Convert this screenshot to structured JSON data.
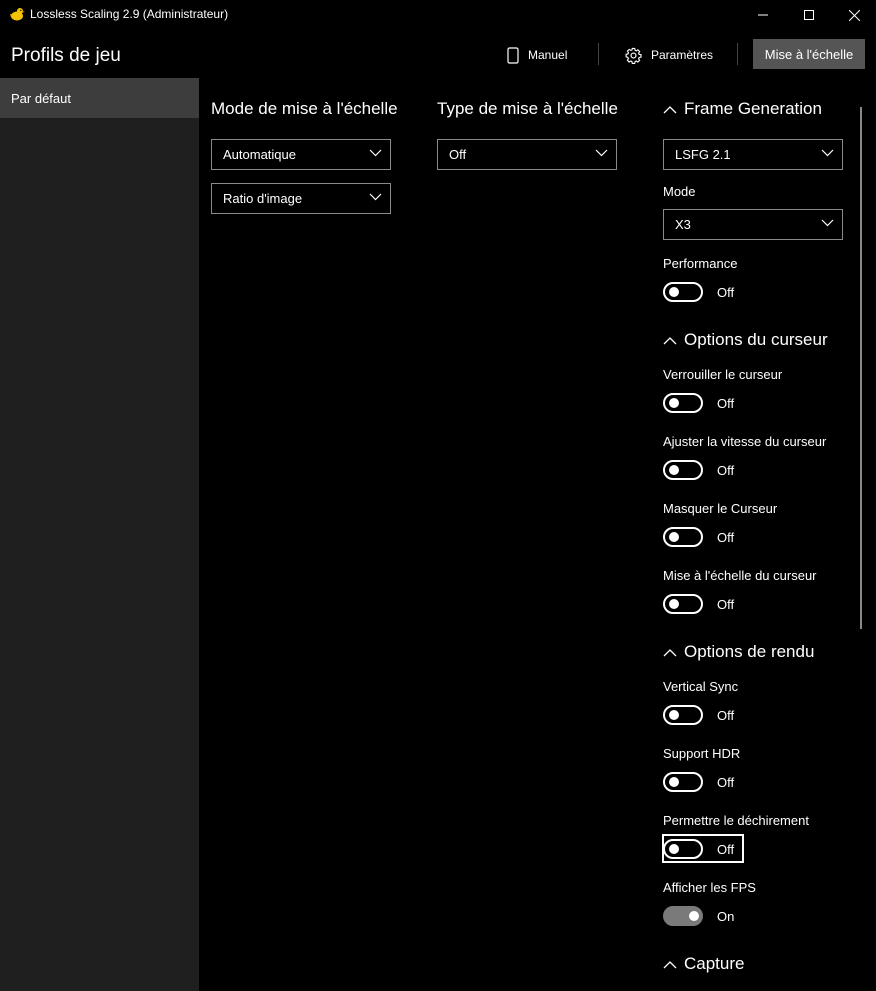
{
  "window": {
    "title": "Lossless Scaling 2.9 (Administrateur)"
  },
  "header": {
    "title": "Profils de jeu",
    "manual_label": "Manuel",
    "settings_label": "Paramètres",
    "scale_button_label": "Mise à l'échelle"
  },
  "sidebar": {
    "items": [
      {
        "label": "Par défaut",
        "selected": true
      }
    ]
  },
  "main": {
    "scaling_mode": {
      "title": "Mode de mise à l'échelle",
      "mode_value": "Automatique",
      "ratio_value": "Ratio d'image"
    },
    "scaling_type": {
      "title": "Type de mise à l'échelle",
      "value": "Off"
    }
  },
  "frame_generation": {
    "title": "Frame Generation",
    "version_value": "LSFG 2.1",
    "mode_label": "Mode",
    "mode_value": "X3",
    "performance_label": "Performance",
    "performance_state": "Off"
  },
  "cursor_options": {
    "title": "Options du curseur",
    "lock_label": "Verrouiller le curseur",
    "lock_state": "Off",
    "speed_label": "Ajuster la vitesse du curseur",
    "speed_state": "Off",
    "hide_label": "Masquer le Curseur",
    "hide_state": "Off",
    "scale_label": "Mise à l'échelle du curseur",
    "scale_state": "Off"
  },
  "render_options": {
    "title": "Options de rendu",
    "vsync_label": "Vertical Sync",
    "vsync_state": "Off",
    "hdr_label": "Support HDR",
    "hdr_state": "Off",
    "tearing_label": "Permettre le déchirement",
    "tearing_state": "Off",
    "fps_label": "Afficher les FPS",
    "fps_state": "On"
  },
  "capture": {
    "title": "Capture"
  },
  "icons": {
    "app": "duck-icon",
    "manual": "phone-icon",
    "settings": "gear-icon",
    "collapse": "chevron-up-icon",
    "dropdown": "chevron-down-icon"
  },
  "colors": {
    "background": "#000000",
    "sidebar": "#1f1f1f",
    "sidebar_selected": "#3d3d3d",
    "accent_button": "#555555",
    "toggle_on": "#7a7a7a"
  }
}
